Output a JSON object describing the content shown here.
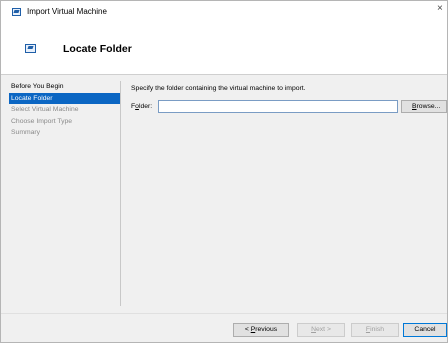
{
  "window": {
    "title": "Import Virtual Machine",
    "close_glyph": "×"
  },
  "header": {
    "title": "Locate Folder"
  },
  "steps": [
    {
      "label": "Before You Begin",
      "state": "done"
    },
    {
      "label": "Locate Folder",
      "state": "active"
    },
    {
      "label": "Select Virtual Machine",
      "state": "pending"
    },
    {
      "label": "Choose Import Type",
      "state": "pending"
    },
    {
      "label": "Summary",
      "state": "pending"
    }
  ],
  "content": {
    "instruction": "Specify the folder containing the virtual machine to import.",
    "folder_label_pre": "F",
    "folder_label_mn": "o",
    "folder_label_post": "lder:",
    "folder_value": "",
    "browse_mn": "B",
    "browse_rest": "rowse..."
  },
  "buttons": {
    "previous_pre": "< ",
    "previous_mn": "P",
    "previous_rest": "revious",
    "next_pre": "",
    "next_mn": "N",
    "next_rest": "ext >",
    "finish_mn": "F",
    "finish_rest": "inish",
    "cancel": "Cancel"
  },
  "colors": {
    "accent": "#0b66c3",
    "disabled_text": "#a0a0a0"
  },
  "icons": {
    "window": "vm-import-icon",
    "header": "vm-import-icon"
  }
}
